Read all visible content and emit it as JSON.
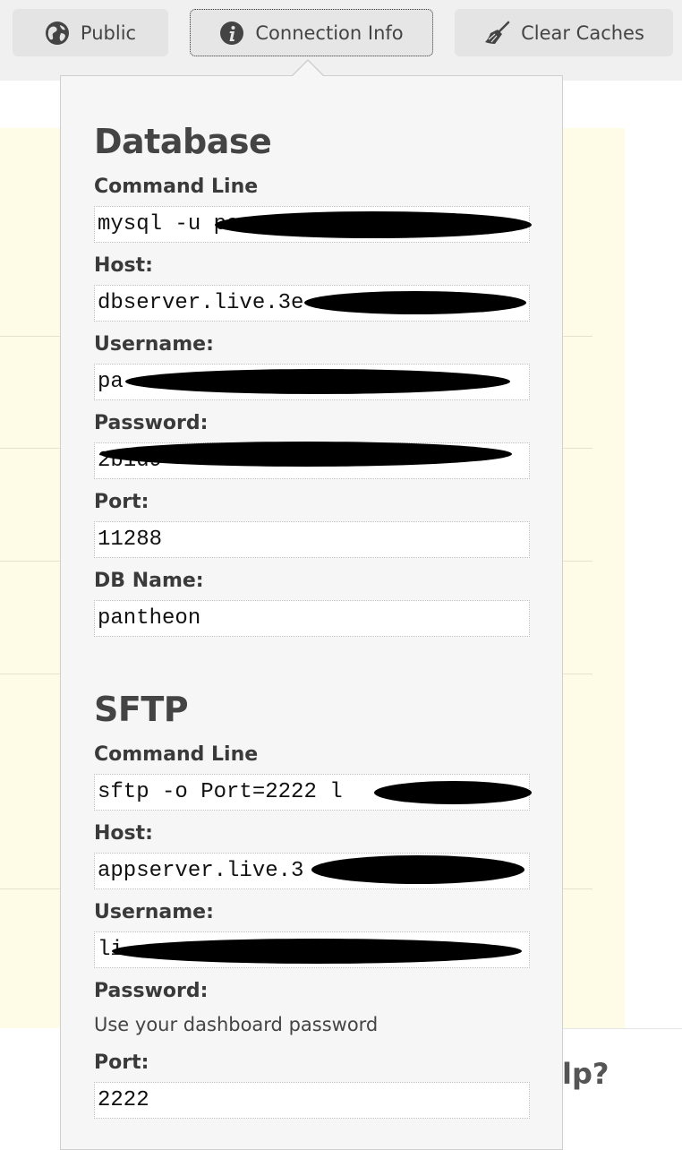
{
  "toolbar": {
    "buttons": [
      {
        "label": "Public",
        "icon": "globe-icon"
      },
      {
        "label": "Connection Info",
        "icon": "info-icon"
      },
      {
        "label": "Clear Caches",
        "icon": "broom-icon"
      }
    ]
  },
  "background": {
    "help_text": "lp?"
  },
  "connection_info": {
    "database": {
      "title": "Database",
      "fields": [
        {
          "label": "Command Line",
          "value": "mysql -u pa"
        },
        {
          "label": "Host:",
          "value": "dbserver.live.3e"
        },
        {
          "label": "Username:",
          "value": "pa"
        },
        {
          "label": "Password:",
          "value": "2b1d9"
        },
        {
          "label": "Port:",
          "value": "11288"
        },
        {
          "label": "DB Name:",
          "value": "pantheon"
        }
      ]
    },
    "sftp": {
      "title": "SFTP",
      "fields": [
        {
          "label": "Command Line",
          "value": "sftp -o Port=2222 l"
        },
        {
          "label": "Host:",
          "value": "appserver.live.3"
        },
        {
          "label": "Username:",
          "value": "li"
        },
        {
          "label": "Password:",
          "value": "Use your dashboard password"
        },
        {
          "label": "Port:",
          "value": "2222"
        }
      ]
    }
  },
  "colors": {
    "popover_bg": "#f6f6f6",
    "page_bg": "#fefbe6",
    "toolbar_bg": "#f0f0f0"
  }
}
